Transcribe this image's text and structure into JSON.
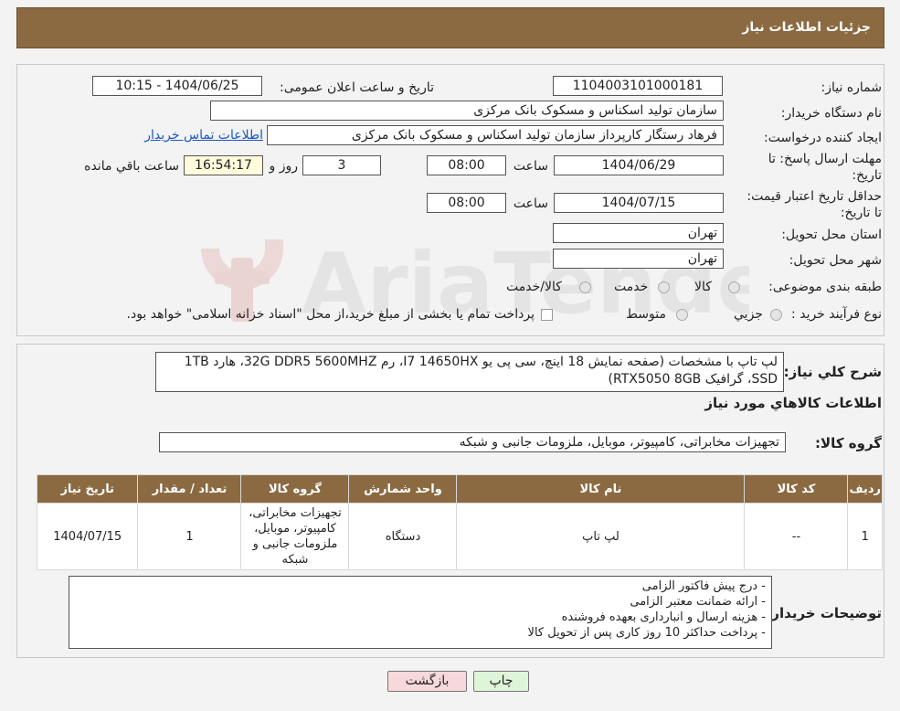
{
  "header": {
    "title": "جزئیات اطلاعات نیاز"
  },
  "fields": {
    "need_number_label": "شماره نیاز:",
    "need_number": "1104003101000181",
    "announce_label": "تاریخ و ساعت اعلان عمومی:",
    "announce_value": "1404/06/25 - 10:15",
    "buyer_org_label": "نام دستگاه خریدار:",
    "buyer_org": "سازمان تولید اسکناس و مسکوک بانک مرکزی",
    "creator_label": "ایجاد کننده درخواست:",
    "creator": "فرهاد رستگار کارپرداز سازمان تولید اسکناس و مسکوک بانک مرکزی",
    "contact_link": "اطلاعات تماس خریدار",
    "deadline_label": "مهلت ارسال پاسخ: تا تاریخ:",
    "deadline_date": "1404/06/29",
    "time_label": "ساعت",
    "deadline_time": "08:00",
    "days_value": "3",
    "days_label": "روز و",
    "remaining_time": "16:54:17",
    "remaining_label": "ساعت باقي مانده",
    "validity_label": "حداقل تاریخ اعتبار قیمت: تا تاریخ:",
    "validity_date": "1404/07/15",
    "validity_time": "08:00",
    "province_label": "استان محل تحویل:",
    "province": "تهران",
    "city_label": "شهر محل تحویل:",
    "city": "تهران",
    "category_label": "طبقه بندی موضوعی:",
    "category_options": [
      "کالا",
      "خدمت",
      "کالا/خدمت"
    ],
    "process_label": "نوع فرآیند خرید :",
    "process_options": [
      "جزیي",
      "متوسط"
    ],
    "process_note": "پرداخت تمام یا بخشی از مبلغ خرید،از محل \"اسناد خزانه اسلامی\" خواهد بود."
  },
  "description": {
    "label": "شرح کلي نیاز:",
    "text": "لپ تاپ با مشخصات (صفحه نمایش 18 اینچ، سی پی یو I7 14650HX، رم 32G DDR5 5600MHZ، هارد 1TB SSD، گرافیک RTX5050 8GB)"
  },
  "goods_info_title": "اطلاعات کالاهاي مورد نیاز",
  "goods_group": {
    "label": "گروه کالا:",
    "value": "تجهیزات مخابراتی، کامپیوتر، موبایل، ملزومات جانبی و شبکه"
  },
  "table": {
    "headers": [
      "ردیف",
      "کد کالا",
      "نام کالا",
      "واحد شمارش",
      "گروه کالا",
      "تعداد / مقدار",
      "تاریخ نیاز"
    ],
    "rows": [
      [
        "1",
        "--",
        "لپ تاپ",
        "دستگاه",
        "تجهیزات مخابراتی، کامپیوتر، موبایل، ملزومات جانبی و شبکه",
        "1",
        "1404/07/15"
      ]
    ]
  },
  "buyer_notes": {
    "label": "توضیحات خریدار:",
    "lines": [
      "- درج پیش فاکتور الزامی",
      "- ارائه ضمانت معتبر الزامی",
      "- هزینه ارسال و انبارداری بعهده فروشنده",
      "- پرداخت حداکثر 10 روز کاری پس از تحویل کالا"
    ]
  },
  "buttons": {
    "print": "چاپ",
    "back": "بازگشت"
  },
  "colors": {
    "header": "#8b6a42",
    "back_button": "#f7d9db",
    "print_button": "#dff5d9",
    "link": "#1a56c4"
  }
}
